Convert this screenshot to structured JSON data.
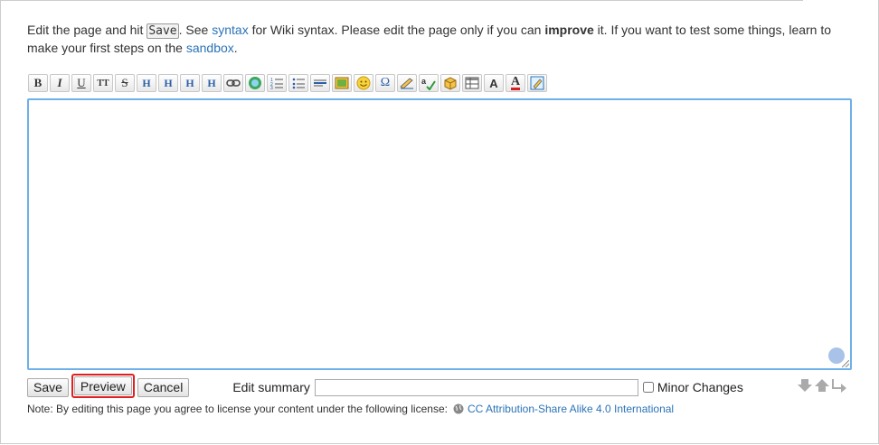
{
  "intro": {
    "part1": "Edit the page and hit ",
    "save_key": "Save",
    "part2": ". See ",
    "syntax_link": "syntax",
    "part3": " for Wiki syntax. Please edit the page only if you can ",
    "improve": "improve",
    "part4": " it. If you want to test some things, learn to make your first steps on the ",
    "sandbox_link": "sandbox",
    "part5": "."
  },
  "toolbar": {
    "buttons": [
      {
        "icon": "bold-icon",
        "label": "B"
      },
      {
        "icon": "italic-icon",
        "label": "I"
      },
      {
        "icon": "underline-icon",
        "label": "U"
      },
      {
        "icon": "monospace-icon",
        "label": "TT"
      },
      {
        "icon": "strikethrough-icon",
        "label": "S"
      },
      {
        "icon": "headline-same-level-icon",
        "label": "H"
      },
      {
        "icon": "headline-lower-icon",
        "label": "H"
      },
      {
        "icon": "headline-higher-icon",
        "label": "H"
      },
      {
        "icon": "headline-menu-icon",
        "label": "H"
      },
      {
        "icon": "link-icon",
        "label": ""
      },
      {
        "icon": "external-link-icon",
        "label": ""
      },
      {
        "icon": "ordered-list-icon",
        "label": ""
      },
      {
        "icon": "unordered-list-icon",
        "label": ""
      },
      {
        "icon": "horizontal-rule-icon",
        "label": ""
      },
      {
        "icon": "image-icon",
        "label": ""
      },
      {
        "icon": "smiley-icon",
        "label": ""
      },
      {
        "icon": "special-chars-icon",
        "label": "Ω"
      },
      {
        "icon": "signature-icon",
        "label": ""
      },
      {
        "icon": "spell-check-icon",
        "label": ""
      },
      {
        "icon": "plugin-box-icon",
        "label": ""
      },
      {
        "icon": "table-icon",
        "label": ""
      },
      {
        "icon": "font-size-icon",
        "label": "A"
      },
      {
        "icon": "font-color-icon",
        "label": "A"
      },
      {
        "icon": "edit-note-icon",
        "label": ""
      }
    ]
  },
  "editor": {
    "value": ""
  },
  "actions": {
    "save_label": "Save",
    "preview_label": "Preview",
    "cancel_label": "Cancel",
    "summary_label": "Edit summary",
    "summary_value": "",
    "minor_label": "Minor Changes",
    "minor_checked": false
  },
  "note": {
    "text": "Note: By editing this page you agree to license your content under the following license:",
    "license_link": "CC Attribution-Share Alike 4.0 International"
  },
  "colors": {
    "link": "#2b73b7",
    "highlight": "#e02020",
    "editor_border": "#6eb0ea"
  }
}
